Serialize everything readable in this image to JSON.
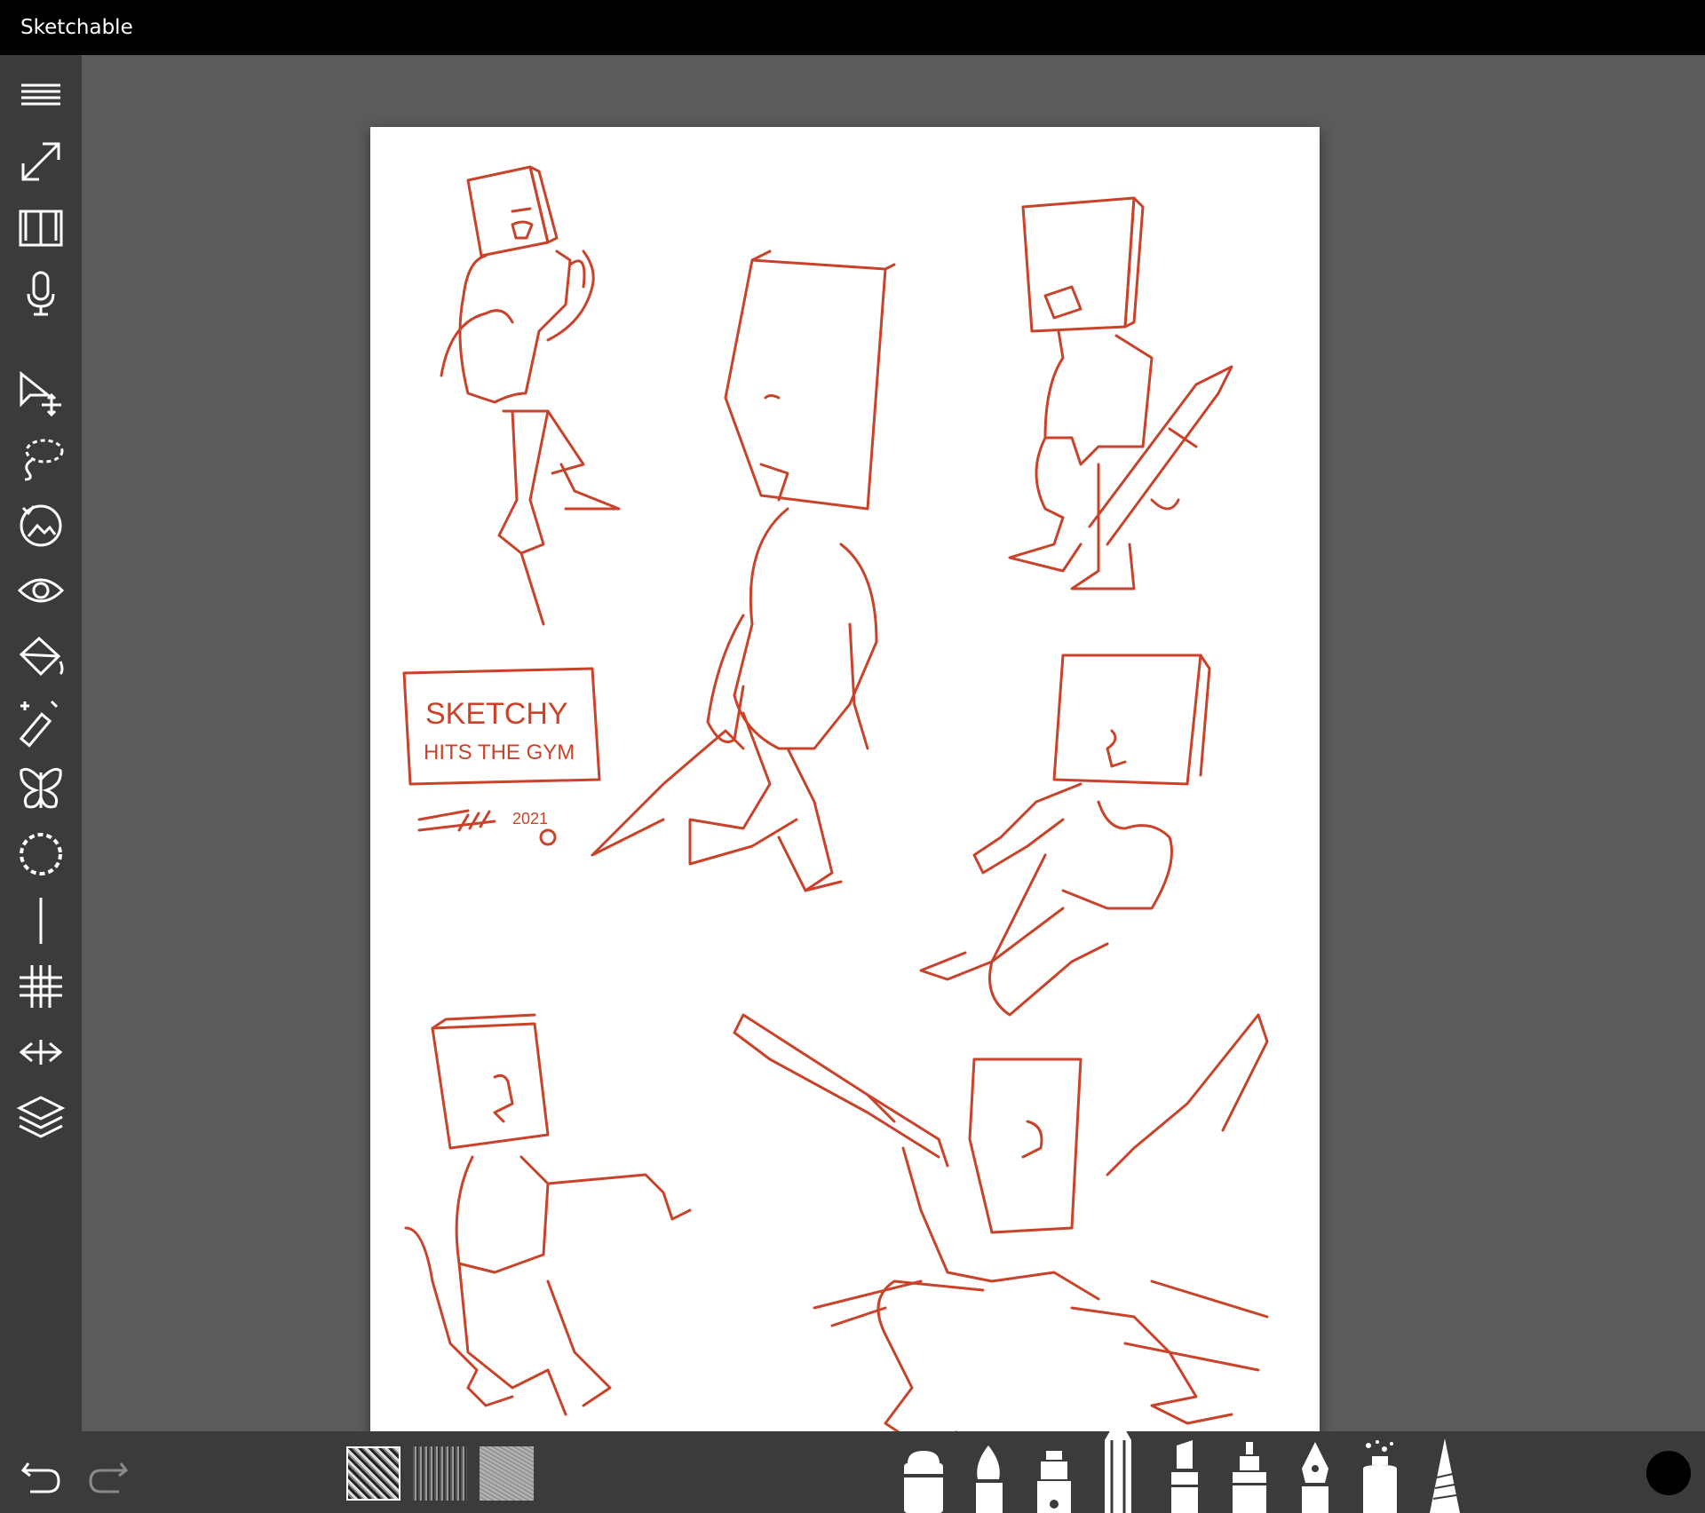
{
  "app": {
    "title": "Sketchable"
  },
  "sidebar": {
    "tools": [
      {
        "name": "menu-icon",
        "label": "Menu"
      },
      {
        "name": "fullscreen-icon",
        "label": "Full screen"
      },
      {
        "name": "book-icon",
        "label": "Journal"
      },
      {
        "name": "microphone-icon",
        "label": "Voice note"
      },
      {
        "name": "select-move-icon",
        "label": "Select and move"
      },
      {
        "name": "lasso-icon",
        "label": "Lasso"
      },
      {
        "name": "image-rotate-icon",
        "label": "Rotate image"
      },
      {
        "name": "eye-icon",
        "label": "Visibility"
      },
      {
        "name": "fill-bucket-icon",
        "label": "Fill"
      },
      {
        "name": "magic-wand-icon",
        "label": "Magic wand"
      },
      {
        "name": "butterfly-icon",
        "label": "Symmetry"
      },
      {
        "name": "circle-guide-icon",
        "label": "Circle guide"
      },
      {
        "name": "line-guide-icon",
        "label": "Line guide"
      },
      {
        "name": "grid-icon",
        "label": "Grid"
      },
      {
        "name": "perspective-icon",
        "label": "Perspective"
      },
      {
        "name": "layers-icon",
        "label": "Layers"
      }
    ]
  },
  "canvas": {
    "sign_line1": "SKETCHY",
    "sign_line2": "HITS THE GYM",
    "signature": "2021"
  },
  "bottombar": {
    "textures": [
      "noise",
      "stripes",
      "grain"
    ],
    "brushes": [
      {
        "name": "eraser-brush-icon",
        "label": "Eraser"
      },
      {
        "name": "paintbrush-brush-icon",
        "label": "Paint brush"
      },
      {
        "name": "marker-brush-icon",
        "label": "Marker"
      },
      {
        "name": "pencil-brush-icon",
        "label": "Pencil"
      },
      {
        "name": "highlighter-brush-icon",
        "label": "Highlighter"
      },
      {
        "name": "felt-pen-brush-icon",
        "label": "Felt pen"
      },
      {
        "name": "fountain-pen-brush-icon",
        "label": "Fountain pen"
      },
      {
        "name": "spray-can-brush-icon",
        "label": "Spray"
      },
      {
        "name": "ink-pen-brush-icon",
        "label": "Ink pen"
      }
    ],
    "current_color": "#000000",
    "stroke_color": "#c8432a"
  }
}
